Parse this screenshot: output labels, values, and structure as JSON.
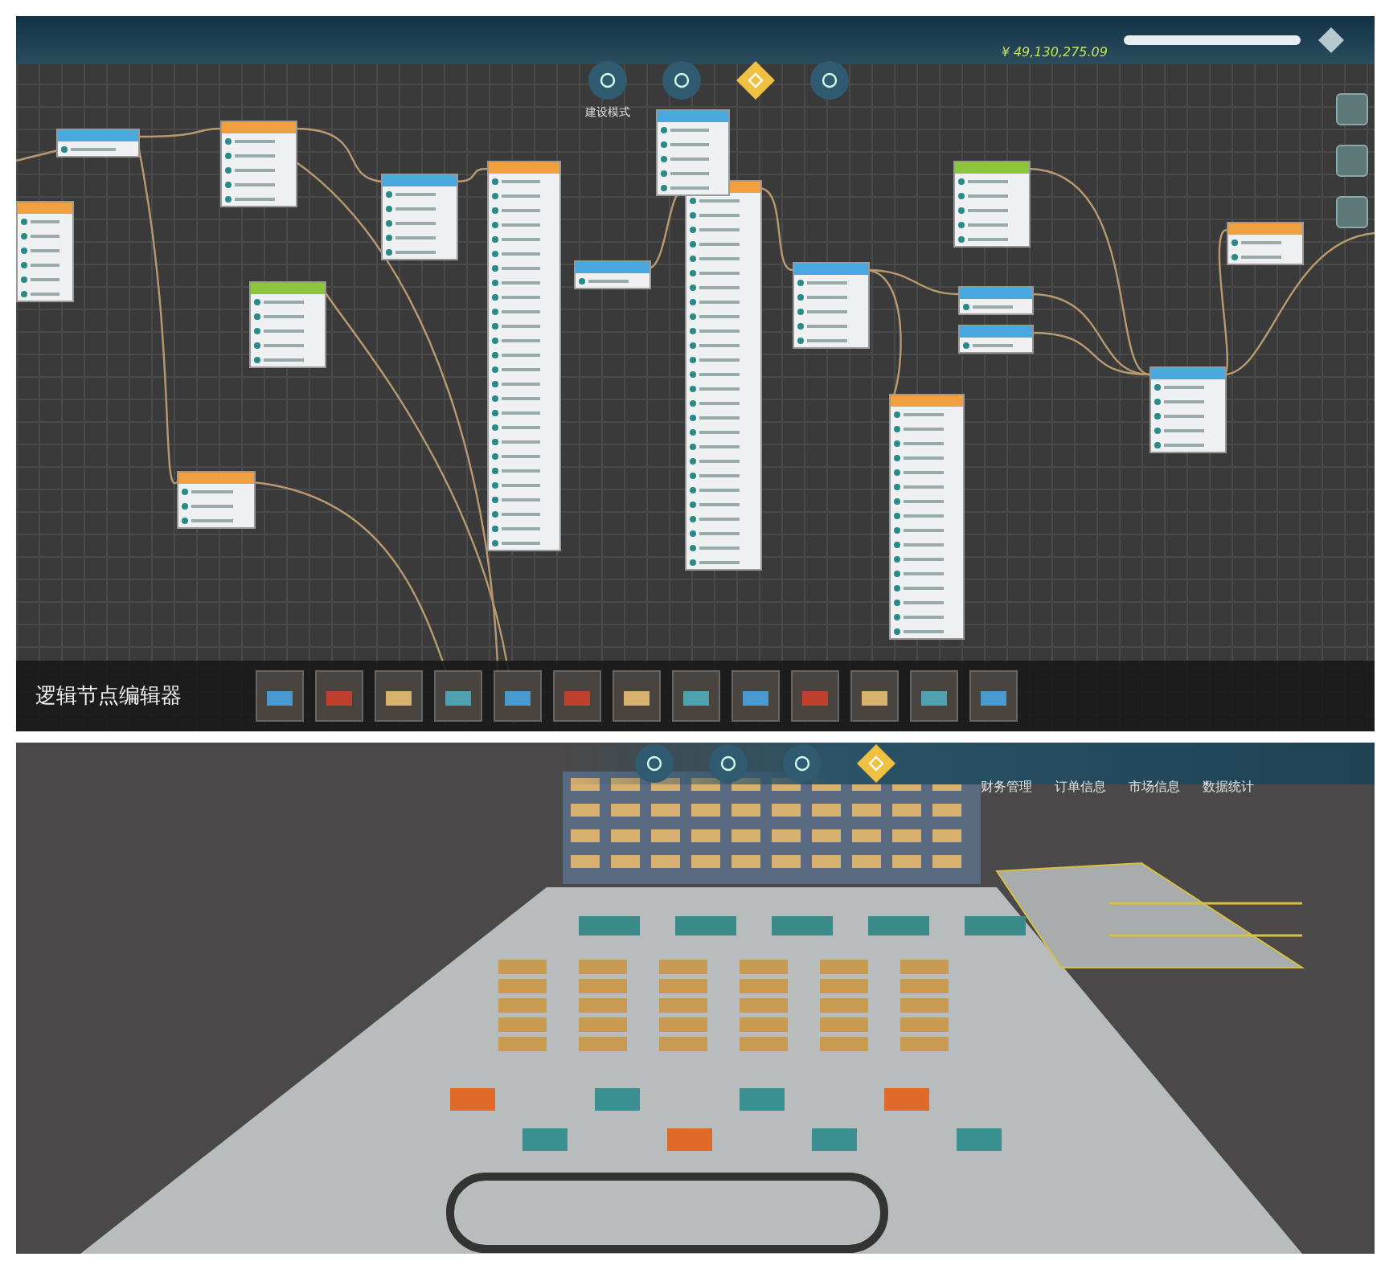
{
  "node_editor": {
    "title": "逻辑节点编辑器",
    "money": "¥ 49,130,275.09",
    "modes": [
      {
        "label": "建设模式",
        "selected": false
      },
      {
        "selected": false
      },
      {
        "selected": true
      },
      {
        "selected": false
      }
    ],
    "nodes": [
      {
        "color": "#4aa8e0"
      },
      {
        "color": "#f0a040"
      },
      {
        "color": "#f0a040"
      },
      {
        "color": "#4aa8e0"
      },
      {
        "color": "#f0a040"
      },
      {
        "color": "#8cc43c"
      },
      {
        "color": "#4aa8e0"
      },
      {
        "color": "#f0a040"
      },
      {
        "color": "#4aa8e0"
      },
      {
        "color": "#8cc43c"
      },
      {
        "color": "#4aa8e0"
      },
      {
        "color": "#4aa8e0"
      },
      {
        "color": "#4aa8e0"
      },
      {
        "color": "#f0a040"
      },
      {
        "color": "#4aa8e0"
      },
      {
        "color": "#f0a040"
      },
      {
        "color": "#f0a040"
      }
    ]
  },
  "warehouse_view": {
    "nav": [
      {
        "selected": false
      },
      {
        "selected": false
      },
      {
        "selected": false
      },
      {
        "selected": true
      }
    ],
    "menu": [
      "财务管理",
      "订单信息",
      "市场信息",
      "数据统计"
    ]
  }
}
